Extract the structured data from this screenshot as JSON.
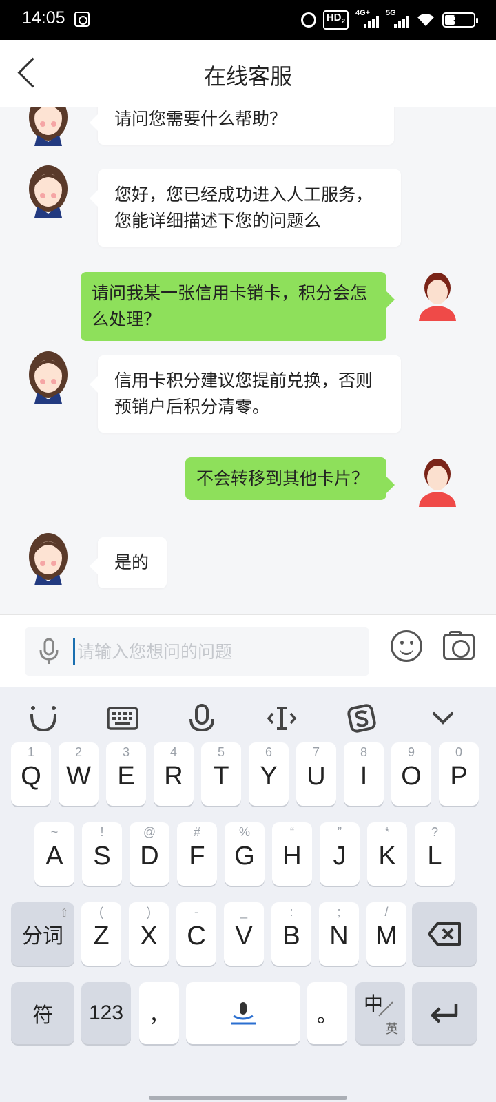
{
  "status_bar": {
    "time": "14:05",
    "hd_label": "HD",
    "hd_sub": "2",
    "sim1_label": "4G+",
    "sim2_label": "5G",
    "battery": "34"
  },
  "header": {
    "title": "在线客服"
  },
  "messages": [
    {
      "side": "agent",
      "text": "请问您需要什么帮助？"
    },
    {
      "side": "agent",
      "text": "您好，您已经成功进入人工服务，您能详细描述下您的问题么"
    },
    {
      "side": "user",
      "text": "请问我某一张信用卡销卡，积分会怎么处理？"
    },
    {
      "side": "agent",
      "text": "信用卡积分建议您提前兑换，否则预销户后积分清零。"
    },
    {
      "side": "user",
      "text": "不会转移到其他卡片？"
    },
    {
      "side": "agent",
      "text": "是的"
    }
  ],
  "input": {
    "placeholder": "请输入您想问的问题",
    "value": ""
  },
  "keyboard": {
    "row1": [
      {
        "main": "Q",
        "sub": "1"
      },
      {
        "main": "W",
        "sub": "2"
      },
      {
        "main": "E",
        "sub": "3"
      },
      {
        "main": "R",
        "sub": "4"
      },
      {
        "main": "T",
        "sub": "5"
      },
      {
        "main": "Y",
        "sub": "6"
      },
      {
        "main": "U",
        "sub": "7"
      },
      {
        "main": "I",
        "sub": "8"
      },
      {
        "main": "O",
        "sub": "9"
      },
      {
        "main": "P",
        "sub": "0"
      }
    ],
    "row2": [
      {
        "main": "A",
        "sub": "~"
      },
      {
        "main": "S",
        "sub": "!"
      },
      {
        "main": "D",
        "sub": "@"
      },
      {
        "main": "F",
        "sub": "#"
      },
      {
        "main": "G",
        "sub": "%"
      },
      {
        "main": "H",
        "sub": "“"
      },
      {
        "main": "J",
        "sub": "”"
      },
      {
        "main": "K",
        "sub": "*"
      },
      {
        "main": "L",
        "sub": "?"
      }
    ],
    "row3": [
      {
        "main": "Z",
        "sub": "("
      },
      {
        "main": "X",
        "sub": ")"
      },
      {
        "main": "C",
        "sub": "-"
      },
      {
        "main": "V",
        "sub": "_"
      },
      {
        "main": "B",
        "sub": ":"
      },
      {
        "main": "N",
        "sub": ";"
      },
      {
        "main": "M",
        "sub": "/"
      }
    ],
    "shift_label": "分词",
    "symbols_label": "符",
    "numbers_label": "123",
    "comma_label": "，",
    "period_label": "。",
    "lang_main": "中",
    "lang_sub": "英"
  },
  "colors": {
    "user_bubble": "#8ee05b",
    "agent_bubble": "#ffffff",
    "chat_bg": "#f5f6f8",
    "keyboard_bg": "#eef0f5",
    "caret": "#1a6fb0"
  }
}
